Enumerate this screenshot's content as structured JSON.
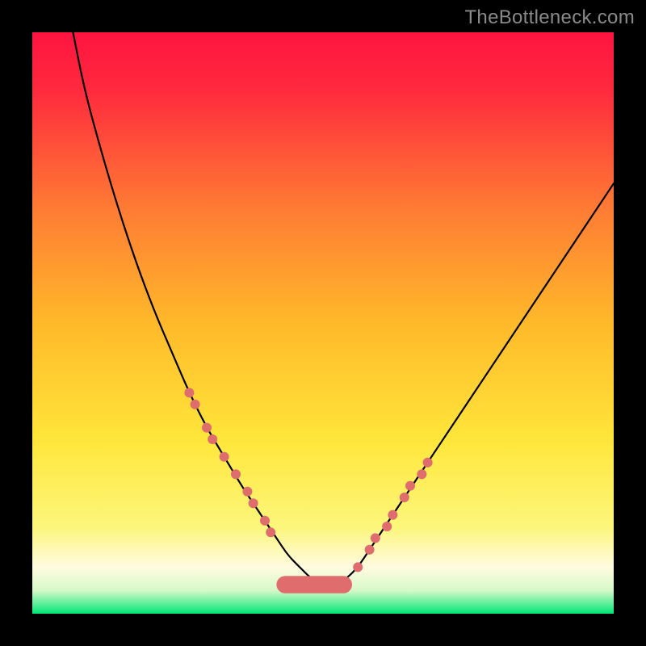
{
  "watermark": "TheBottleneck.com",
  "chart_data": {
    "type": "line",
    "title": "",
    "xlabel": "",
    "ylabel": "",
    "xlim": [
      0,
      100
    ],
    "ylim": [
      0,
      100
    ],
    "grid": false,
    "legend": false,
    "background_gradient": {
      "top_color": "#ff1a3f",
      "mid_color": "#ffe63a",
      "bottom_band_color": "#fff9d9",
      "bottom_edge_color": "#00e676"
    },
    "series": [
      {
        "name": "curve",
        "stroke": "#000000",
        "stroke_width": 2,
        "x": [
          7,
          9,
          12,
          15,
          18,
          21,
          24,
          27,
          30,
          33,
          36,
          38,
          40,
          42,
          44,
          46,
          48,
          50,
          52,
          54,
          56,
          58,
          60,
          64,
          68,
          72,
          76,
          80,
          84,
          88,
          92,
          96,
          100
        ],
        "y": [
          100,
          90,
          79,
          69,
          60,
          52,
          45,
          38,
          32,
          27,
          22,
          19,
          16,
          13,
          10,
          8,
          6,
          5,
          5,
          6,
          8,
          11,
          14,
          20,
          26,
          32,
          38,
          44,
          50,
          56,
          62,
          68,
          74
        ]
      },
      {
        "name": "dots-left",
        "stroke": "none",
        "marker": "circle",
        "marker_color": "#df6d6d",
        "marker_radius": 6,
        "x": [
          27,
          28,
          30,
          31,
          33,
          35,
          37,
          38,
          40,
          41
        ],
        "y": [
          38,
          36,
          32,
          30,
          27,
          24,
          21,
          19,
          16,
          14
        ]
      },
      {
        "name": "dots-right",
        "stroke": "none",
        "marker": "circle",
        "marker_color": "#df6d6d",
        "marker_radius": 6,
        "x": [
          56,
          58,
          59,
          61,
          62,
          64,
          65,
          67,
          68
        ],
        "y": [
          8,
          11,
          13,
          15,
          17,
          20,
          22,
          24,
          26
        ]
      },
      {
        "name": "bottom-band",
        "type": "rounded_bar",
        "color": "#df6d6d",
        "x_range": [
          42,
          55
        ],
        "y": 5,
        "height": 3
      }
    ]
  }
}
